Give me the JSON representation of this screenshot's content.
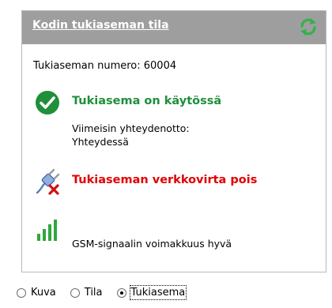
{
  "panel": {
    "title": "Kodin tukiaseman tila",
    "refresh_icon": "refresh-icon",
    "station_number": "Tukiaseman numero: 60004",
    "status_ok": "Tukiasema on käytössä",
    "last_contact_label": "Viimeisin yhteydenotto:",
    "last_contact_value": "Yhteydessä",
    "power_status": "Tukiaseman verkkovirta pois",
    "signal_status": "GSM-signaalin voimakkuus hyvä"
  },
  "colors": {
    "header_bg": "#9e9e9e",
    "ok_green": "#1f8f3a",
    "error_red": "#e00000"
  },
  "view_options": [
    {
      "label": "Kuva",
      "selected": false
    },
    {
      "label": "Tila",
      "selected": false
    },
    {
      "label": "Tukiasema",
      "selected": true
    }
  ]
}
